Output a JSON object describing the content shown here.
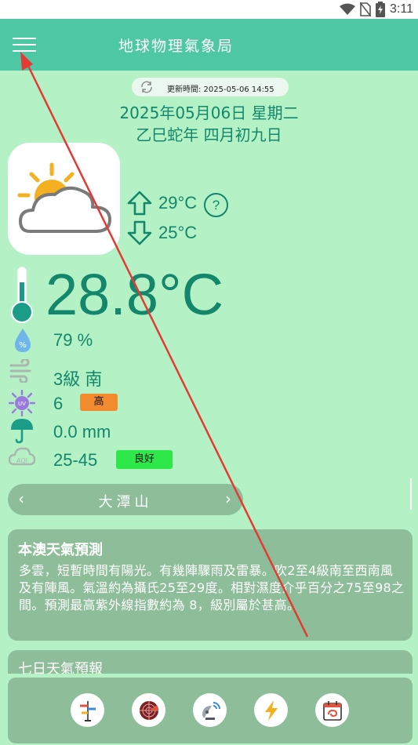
{
  "status_bar": {
    "time": "3:11"
  },
  "app_bar": {
    "title": "地球物理氣象局"
  },
  "update": {
    "label": "更新時間: 2025-05-06 14:55"
  },
  "date": {
    "gregorian": "2025年05月06日 星期二",
    "lunar": "乙巳蛇年 四月初九日"
  },
  "temps": {
    "high": "29°C",
    "low": "25°C",
    "help": "?",
    "current": "28.8°C"
  },
  "readings": {
    "humidity": "79 %",
    "wind": "3級 南",
    "uv": "6",
    "uv_level": "高",
    "rain": "0.0 mm",
    "aqi": "25-45",
    "aqi_level": "良好"
  },
  "station": {
    "name": "大潭山",
    "prev": "‹",
    "next": "›"
  },
  "forecast": {
    "title": "本澳天氣預測",
    "text": "多雲，短暫時間有陽光。有幾陣驟雨及雷暴。吹2至4級南至西南風及有陣風。氣溫約為攝氏25至29度。相對濕度介乎百分之75至98之間。預測最高紫外線指數約為 8，級別屬於甚高。"
  },
  "seven_day": {
    "title": "七日天氣預報"
  },
  "colors": {
    "background": "#b4f2c6",
    "appbar": "#4ec7a4",
    "accent": "#13866b",
    "card": "#8ebe99",
    "uv_badge": "#f28a2e",
    "aqi_badge": "#2ee84a",
    "annotation": "#e53935"
  },
  "icons": {
    "status": [
      "wifi-icon",
      "no-sim-icon",
      "battery-charging-icon"
    ],
    "weather": "partly-cloudy-icon",
    "bottom_nav": [
      "wind-vane-icon",
      "radar-icon",
      "satellite-icon",
      "lightning-icon",
      "typhoon-calendar-icon"
    ]
  }
}
